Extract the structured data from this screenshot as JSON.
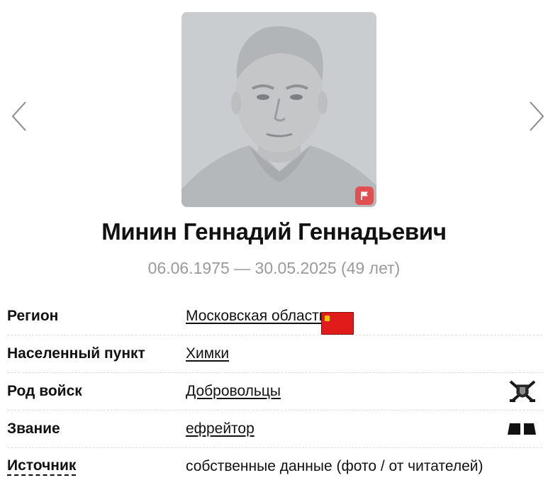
{
  "person": {
    "name": "Минин Геннадий Геннадьевич",
    "dates": "06.06.1975 — 30.05.2025 (49 лет)"
  },
  "details": {
    "region": {
      "label": "Регион",
      "value": "Московская область",
      "icon": "region-flag-icon"
    },
    "settlement": {
      "label": "Населенный пункт",
      "value": "Химки"
    },
    "troops": {
      "label": "Род войск",
      "value": "Добровольцы",
      "icon": "volunteers-emblem-icon"
    },
    "rank": {
      "label": "Звание",
      "value": "ефрейтор",
      "icon": "rank-insignia-icon"
    },
    "source": {
      "label": "Источник",
      "value": "собственные данные (фото / от читателей)"
    }
  },
  "icons": [
    "chevron-left-icon",
    "chevron-right-icon",
    "report-flag-icon"
  ],
  "colors": {
    "region_flag": "#e11a1a",
    "badge": "#e05050",
    "dates_text": "#9a9a9a",
    "photo_bg": "#c9cdd0"
  }
}
